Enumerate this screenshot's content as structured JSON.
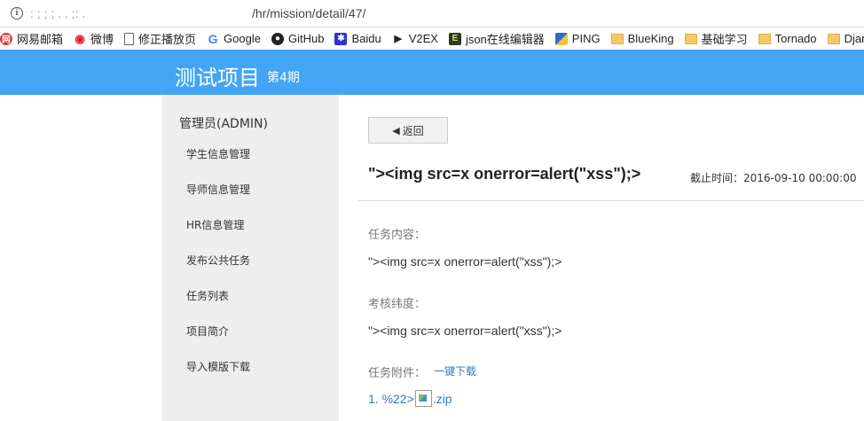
{
  "browser": {
    "url_masked": ":  ;  ;  ; . . ;: .",
    "url_path": "/hr/mission/detail/47/",
    "bookmarks": [
      {
        "label": "网易邮箱",
        "icon": "netease-icon"
      },
      {
        "label": "微博",
        "icon": "weibo-icon"
      },
      {
        "label": "修正播放页",
        "icon": "page-icon"
      },
      {
        "label": "Google",
        "icon": "google-icon"
      },
      {
        "label": "GitHub",
        "icon": "github-icon"
      },
      {
        "label": "Baidu",
        "icon": "baidu-icon"
      },
      {
        "label": "V2EX",
        "icon": "v2ex-icon"
      },
      {
        "label": "json在线编辑器",
        "icon": "json-icon"
      },
      {
        "label": "PING",
        "icon": "ping-icon"
      },
      {
        "label": "BlueKing",
        "icon": "folder-icon"
      },
      {
        "label": "基础学习",
        "icon": "folder-icon"
      },
      {
        "label": "Tornado",
        "icon": "folder-icon"
      },
      {
        "label": "Djan",
        "icon": "folder-icon"
      }
    ]
  },
  "header": {
    "project_title": "测试项目",
    "period": "第4期"
  },
  "sidebar": {
    "user": "管理员(ADMIN)",
    "items": [
      {
        "label": "学生信息管理"
      },
      {
        "label": "导师信息管理"
      },
      {
        "label": "HR信息管理"
      },
      {
        "label": "发布公共任务"
      },
      {
        "label": "任务列表"
      },
      {
        "label": "项目简介"
      },
      {
        "label": "导入模版下载"
      }
    ]
  },
  "main": {
    "back_label": "返回",
    "task_title": "\"><img src=x onerror=alert(\"xss\");>",
    "deadline_label": "截止时间：",
    "deadline_value": "2016-09-10 00:00:00",
    "content_label": "任务内容：",
    "content_value": "\"><img src=x onerror=alert(\"xss\");>",
    "criteria_label": "考核纬度：",
    "criteria_value": "\"><img src=x onerror=alert(\"xss\");>",
    "attachments_label": "任务附件：",
    "download_all_label": "一键下载",
    "attachment_prefix": "1. %22>",
    "attachment_suffix": ".zip"
  },
  "colors": {
    "header_bg": "#42a5f5",
    "sidebar_bg": "#eeeeee",
    "link": "#337ab7"
  }
}
